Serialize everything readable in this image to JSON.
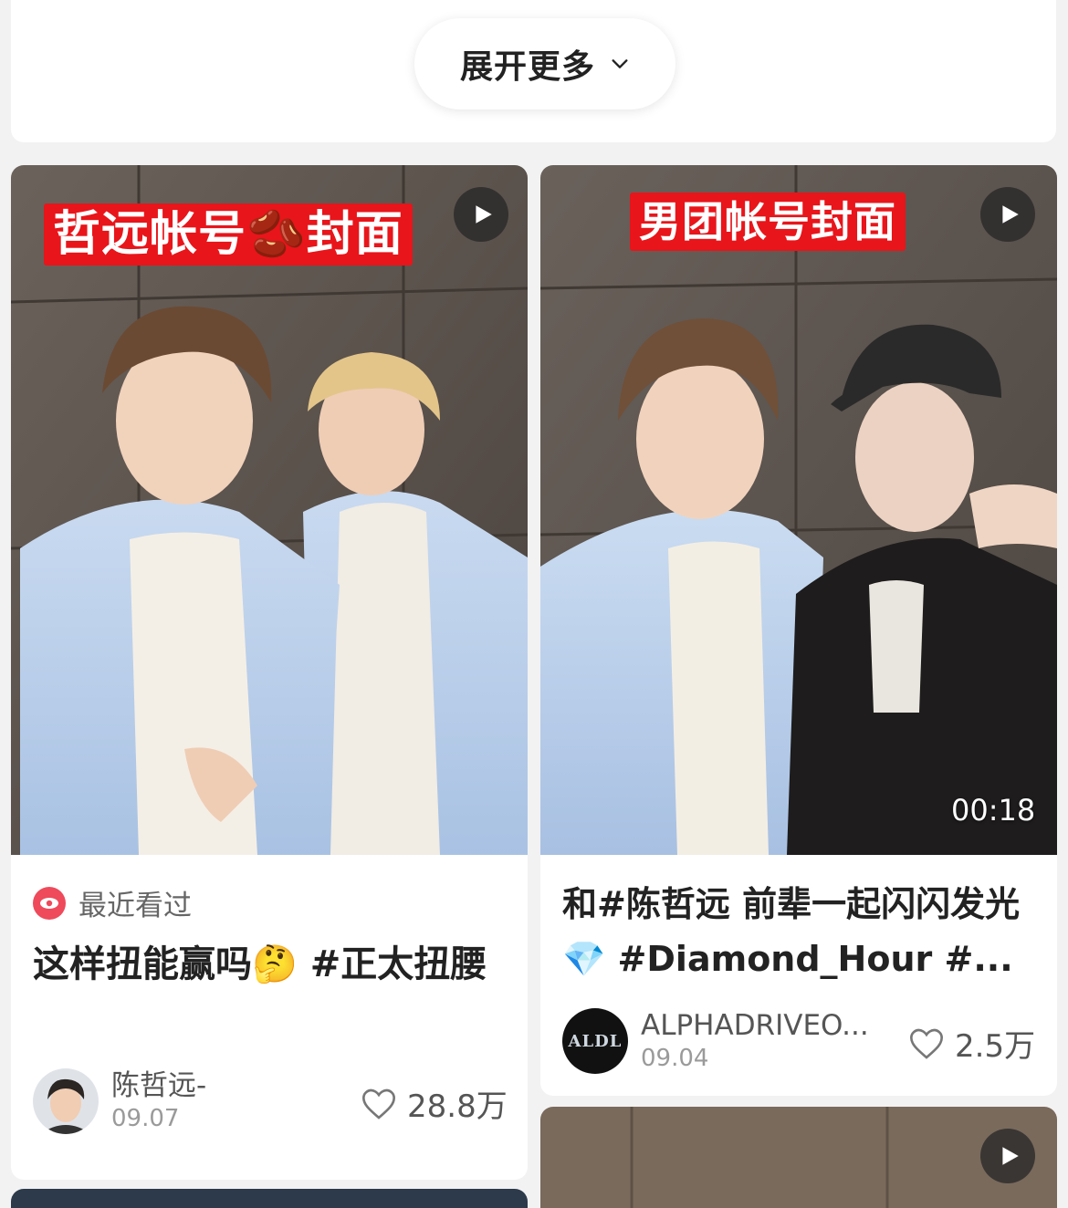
{
  "expand": {
    "label": "展开更多"
  },
  "cards": [
    {
      "cover_tag": "哲远帐号🫘封面",
      "recent_label": "最近看过",
      "title": "这样扭能赢吗🤔 #正太扭腰",
      "author": "陈哲远-",
      "date": "09.07",
      "likes": "28.8万",
      "avatar_text": ""
    },
    {
      "cover_tag": "男团帐号封面",
      "duration": "00:18",
      "title": "和#陈哲远 前辈一起闪闪发光💎 #Diamond_Hour #...",
      "author": "ALPHADRIVEO...",
      "date": "09.04",
      "likes": "2.5万",
      "avatar_text": "ALDL"
    }
  ],
  "icons": [
    "chevron-down-icon",
    "play-icon",
    "eye-icon",
    "heart-icon"
  ],
  "colors": {
    "tag_red": "#e8151b",
    "recent_pink": "#ee4a5b",
    "background": "#f2f2f2"
  }
}
